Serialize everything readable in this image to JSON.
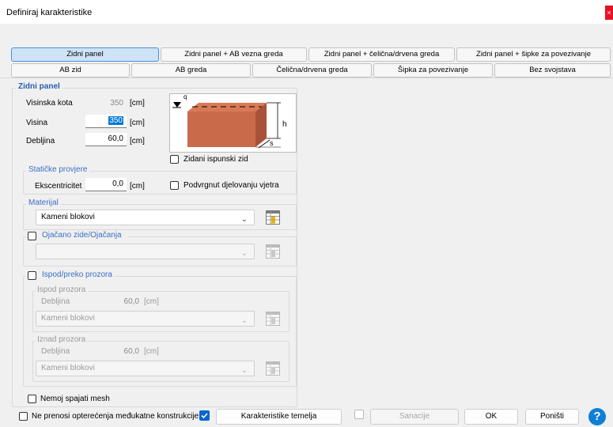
{
  "window": {
    "title": "Definiraj karakteristike",
    "close_glyph": "×"
  },
  "tabs_row1": [
    "Zidni panel",
    "Zidni panel + AB vezna greda",
    "Zidni panel + čelična/drvena greda",
    "Zidni panel + šipke za povezivanje"
  ],
  "tabs_row2": [
    "AB zid",
    "AB greda",
    "Čelična/drvena greda",
    "Šipka za povezivanje",
    "Bez svojstava"
  ],
  "active_tab": "Zidni panel",
  "panel": {
    "title": "Zidni panel",
    "visinska_kota": {
      "label": "Visinska kota",
      "value": "350",
      "unit": "[cm]"
    },
    "visina": {
      "label": "Visina",
      "value": "350",
      "unit": "[cm]"
    },
    "debljina": {
      "label": "Debljina",
      "value": "60,0",
      "unit": "[cm]"
    },
    "diagram": {
      "label_q": "q",
      "label_h": "h",
      "label_s": "s",
      "wall_color": "#c96a4a"
    },
    "zidani_label": "Zidani ispunski zid"
  },
  "staticke": {
    "title": "Statičke provjere",
    "eks_label": "Ekscentricitet",
    "eks_value": "0,0",
    "eks_unit": "[cm]",
    "wind_label": "Podvrgnut djelovanju vjetra"
  },
  "materijal": {
    "title": "Materijal",
    "value": "Kameni blokovi",
    "icon": "material-table-icon"
  },
  "ojacano": {
    "label": "Ojačano zide/Ojačanja",
    "value": ""
  },
  "prozor": {
    "label": "Ispod/preko prozora",
    "ispod": {
      "title": "Ispod prozora",
      "debljina_label": "Debljina",
      "debljina_value": "60,0",
      "unit": "[cm]",
      "material": "Kameni blokovi"
    },
    "iznad": {
      "title": "Iznad prozora",
      "debljina_label": "Debljina",
      "debljina_value": "60,0",
      "unit": "[cm]",
      "material": "Kameni blokovi"
    }
  },
  "nemoj_label": "Nemoj spajati mesh",
  "footer": {
    "ne_prenosi_label": "Ne prenosi opterećenja međukatne konstrukcije",
    "karakteristike_btn": "Karakteristike temelja",
    "sanacije_btn": "Sanacije",
    "ok_btn": "OK",
    "ponisti_btn": "Poništi",
    "help_glyph": "?"
  },
  "colors": {
    "accent": "#0a64d0",
    "active_tab": "#cfe3f7",
    "legend": "#3b6fc4"
  }
}
